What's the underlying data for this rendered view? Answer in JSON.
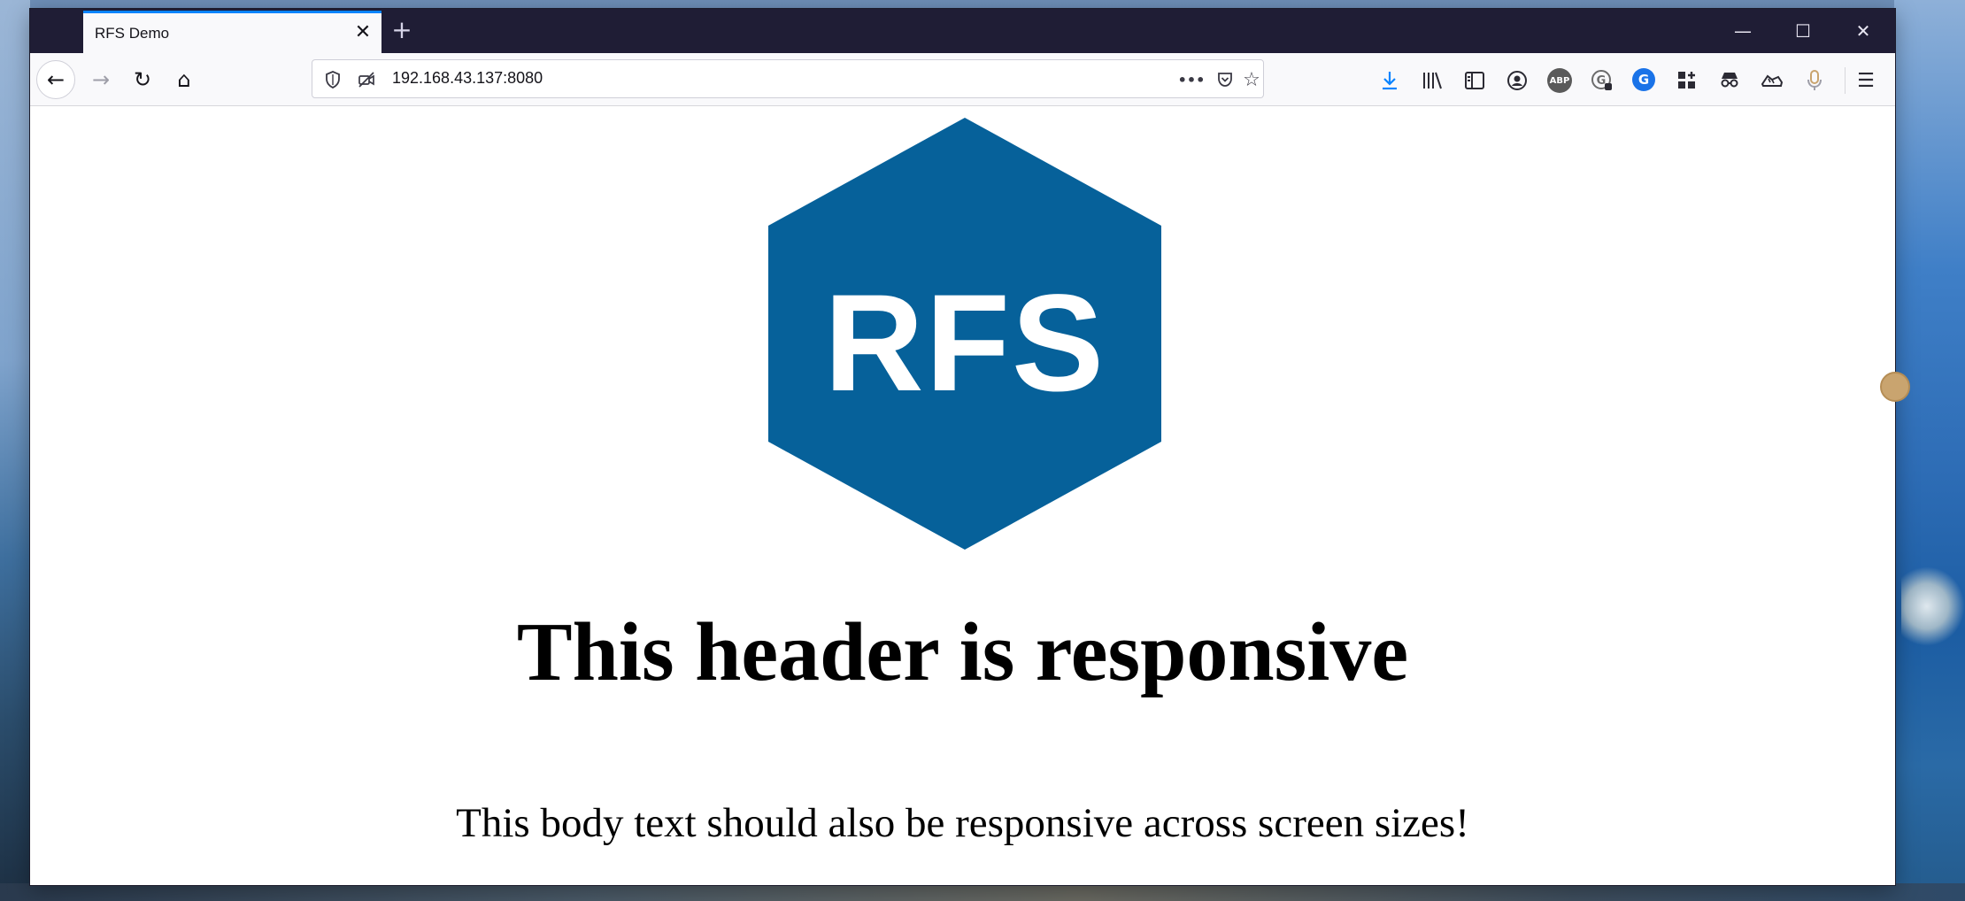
{
  "browser": {
    "tab": {
      "title": "RFS Demo",
      "close_glyph": "✕"
    },
    "new_tab_glyph": "+",
    "window_controls": {
      "minimize": "—",
      "maximize": "☐",
      "close": "✕"
    },
    "nav": {
      "back": "←",
      "forward": "→",
      "reload": "↻",
      "home": "⌂"
    },
    "url": "192.168.43.137:8080",
    "url_icons": {
      "shield": "shield-icon",
      "permissions": "camera-off-icon",
      "more": "•••",
      "pocket": "pocket-icon",
      "bookmark": "☆"
    },
    "toolbar_icons": [
      {
        "name": "downloads-icon",
        "glyph": "⤓",
        "color": "#0a84ff"
      },
      {
        "name": "library-icon",
        "glyph": "Ⅲ",
        "color": "#2b2a33"
      },
      {
        "name": "sidebar-icon",
        "glyph": "▥",
        "color": "#2b2a33"
      },
      {
        "name": "account-icon",
        "glyph": "◉",
        "color": "#2b2a33"
      },
      {
        "name": "adblock-plus-icon",
        "glyph": "ABP",
        "color": "#5a5a5a"
      },
      {
        "name": "extension-g-icon",
        "glyph": "G",
        "color": "#6b6b6b"
      },
      {
        "name": "grammarly-icon",
        "glyph": "G",
        "color": "#15c39a"
      },
      {
        "name": "extensions-grid-icon",
        "glyph": "▚",
        "color": "#2b2a33"
      },
      {
        "name": "spy-icon",
        "glyph": "◐",
        "color": "#2b2a33"
      },
      {
        "name": "shoe-icon",
        "glyph": "⌁",
        "color": "#2b2a33"
      },
      {
        "name": "microphone-icon",
        "glyph": "♪",
        "color": "#c9a46f"
      }
    ],
    "menu_glyph": "☰"
  },
  "page": {
    "logo_text": "RFS",
    "logo_color": "#06619a",
    "heading": "This header is responsive",
    "body": "This body text should also be responsive across screen sizes!"
  }
}
